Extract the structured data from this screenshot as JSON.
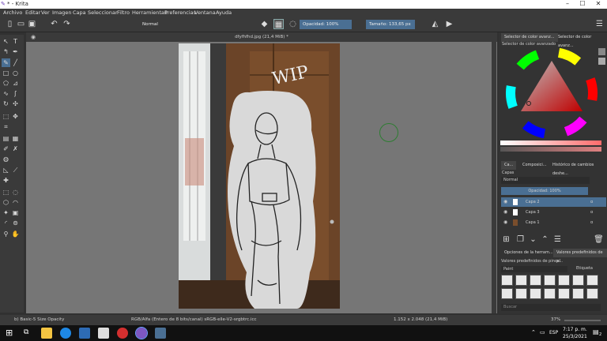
{
  "window": {
    "title": "* - Krita",
    "min": "–",
    "max": "☐",
    "close": "✕"
  },
  "menu": [
    "Archivo",
    "Editar",
    "Ver",
    "Imagen",
    "Capa",
    "Seleccionar",
    "Filtro",
    "Herramientas",
    "Preferencias",
    "Ventana",
    "Ayuda"
  ],
  "toolbar": {
    "blend_mode": "Normal",
    "opacity": "Opacidad: 100%",
    "size": "Tamaño: 133,65 px"
  },
  "document": {
    "tab_title": "dfyfhfhd.jpg (21,4 MiB) *"
  },
  "annotation": "WIP",
  "docker": {
    "tab_advanced_selector": "Selector de color avanz...",
    "tab_advanced_selector_2": "Selector de color avanz...",
    "advanced_selector_header": "Selector de color avanzado",
    "tabs_lower": [
      "Ca...",
      "Composici...",
      "Histórico de cambios deshe..."
    ],
    "layers_title": "Capas",
    "layers_blend": "Normal",
    "layers_opacity": "Opacidad:  100%",
    "layers": [
      {
        "name": "Capa 2",
        "selected": true
      },
      {
        "name": "Capa 3",
        "selected": false
      },
      {
        "name": "Capa 1",
        "selected": false
      }
    ],
    "tool_options_tab": "Opciones de la herram...",
    "brush_presets_tab": "Valores predefinidos de p...",
    "brush_presets_header": "Valores predefinidos de pincel",
    "brush_filter": "Paint",
    "brush_tag": "Etiqueta",
    "search_placeholder": "Buscar"
  },
  "status": {
    "brush": "b) Basic-5 Size Opacity",
    "colorspace": "RGB/Alfa (Entero de 8 bits/canal)  sRGB-elle-V2-srgbtrc.icc",
    "dimensions": "1.152 x 2.048 (21,4 MiB)",
    "zoom": "37%"
  },
  "taskbar": {
    "time": "7:17 p. m.",
    "date": "25/3/2021",
    "lang": "ESP",
    "notif": "2"
  },
  "colors": {
    "ui_dark": "#313131",
    "panel": "#3a3a3a",
    "selected_layer": "#4a6f93",
    "canvas_bg": "#767676"
  }
}
